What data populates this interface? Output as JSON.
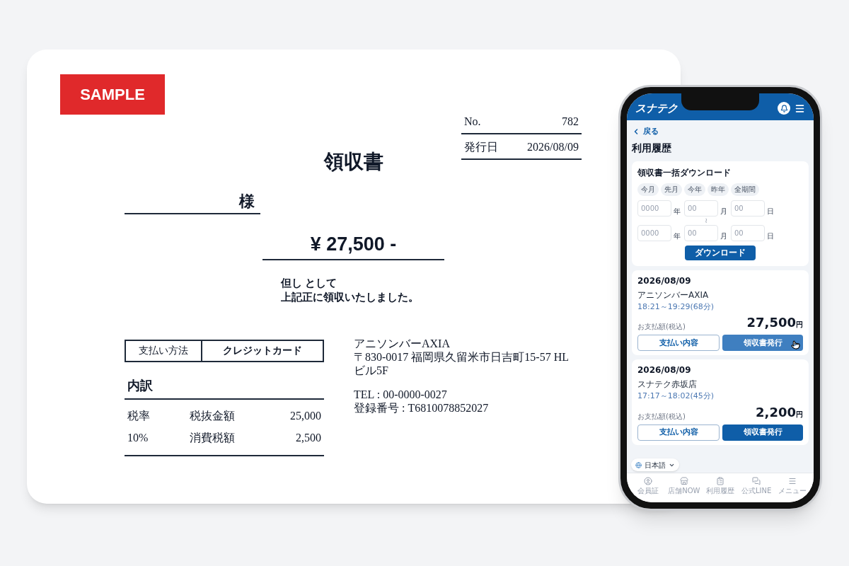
{
  "sample_label": "SAMPLE",
  "receipt": {
    "number_label": "No.",
    "number": "782",
    "date_label": "発行日",
    "date": "2026/08/09",
    "title": "領収書",
    "recipient_suffix": "様",
    "amount": "¥ 27,500 -",
    "note_lines": [
      "但し として",
      "上記正に領収いたしました。"
    ],
    "payment": {
      "label": "支払い方法",
      "value": "クレジットカード"
    },
    "breakdown": {
      "title": "内訳",
      "rows": [
        [
          "税率",
          "税抜金額",
          "25,000"
        ],
        [
          "10%",
          "消費税額",
          "2,500"
        ]
      ]
    },
    "issuer": {
      "address_lines": [
        "アニソンバーAXIA",
        "〒830-0017 福岡県久留米市日吉町15-57 HL",
        "ビル5F"
      ],
      "contact_lines": [
        "TEL : 00-0000-0027",
        "登録番号 : T6810078852027"
      ]
    }
  },
  "phone": {
    "logo": "スナテク",
    "back": "戻る",
    "page_title": "利用履歴",
    "bulk": {
      "title": "領収書一括ダウンロード",
      "presets": [
        "今月",
        "先月",
        "今年",
        "昨年",
        "全期間"
      ],
      "date_rows": [
        [
          {
            "placeholder": "0000",
            "unit": "年"
          },
          {
            "placeholder": "00",
            "unit": "月"
          },
          {
            "placeholder": "00",
            "unit": "日"
          }
        ],
        [
          {
            "placeholder": "0000",
            "unit": "年"
          },
          {
            "placeholder": "00",
            "unit": "月"
          },
          {
            "placeholder": "00",
            "unit": "日"
          }
        ]
      ],
      "range_mark": "≀",
      "download_button": "ダウンロード"
    },
    "history": [
      {
        "date": "2026/08/09",
        "shop": "アニソンバーAXIA",
        "time": "18:21～19:29(68分)",
        "amount_label": "お支払額(税込)",
        "amount": "27,500",
        "currency": "円",
        "details_button": "支払い内容",
        "receipt_button": {
          "label": "領収書発行",
          "hovered": true
        }
      },
      {
        "date": "2026/08/09",
        "shop": "スナテク赤坂店",
        "time": "17:17～18:02(45分)",
        "amount_label": "お支払額(税込)",
        "amount": "2,200",
        "currency": "円",
        "details_button": "支払い内容",
        "receipt_button": {
          "label": "領収書発行",
          "hovered": false
        }
      }
    ],
    "language": "日本語",
    "nav": [
      "会員証",
      "店舗NOW",
      "利用履歴",
      "公式LINE",
      "メニュー"
    ]
  }
}
